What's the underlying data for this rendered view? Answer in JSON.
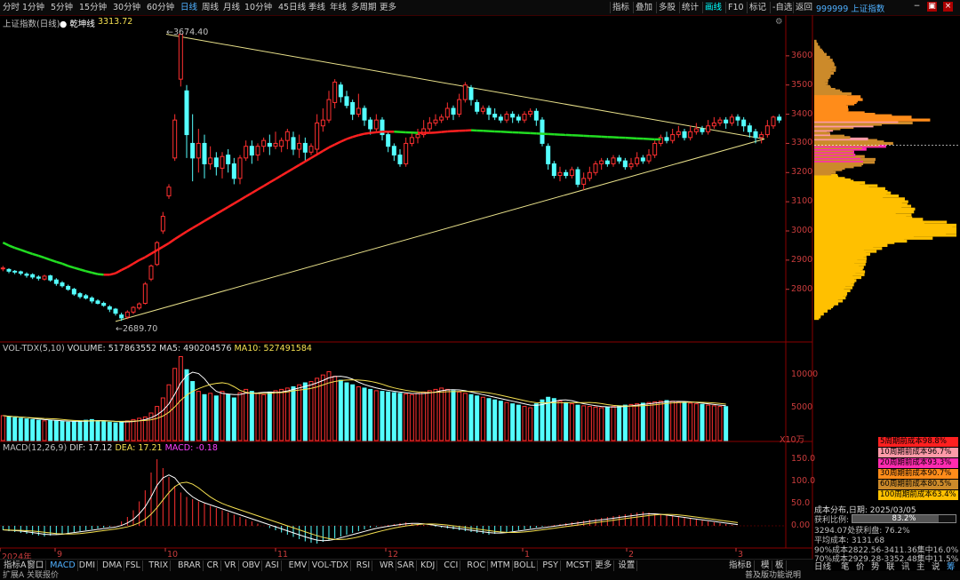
{
  "topbar": {
    "periods": [
      "分时",
      "1分钟",
      "5分钟",
      "15分钟",
      "30分钟",
      "60分钟",
      "日线",
      "周线",
      "月线",
      "10分钟",
      "45日线",
      "季线",
      "年线",
      "多周期",
      "更多"
    ],
    "active_period": "日线",
    "tools": [
      "指标",
      "叠加",
      "多股",
      "统计",
      "画线",
      "F10",
      "标记",
      "-自选",
      "返回"
    ],
    "active_tool": "画线",
    "symbol": "999999 上证指数"
  },
  "main_chart": {
    "name": "上证指数(日线)",
    "indicator": "乾坤线",
    "indicator_value": "3313.72",
    "high_label": "3674.40",
    "low_label": "2689.70",
    "y_ticks": [
      "3600",
      "3500",
      "3400",
      "3300",
      "3200",
      "3100",
      "3000",
      "2900",
      "2800"
    ]
  },
  "vol_panel": {
    "header_name": "VOL-TDX(5,10)",
    "volume": "VOLUME: 517863552",
    "ma5": "MA5: 490204576",
    "ma10": "MA10: 527491584",
    "y_ticks": [
      "10000",
      "5000"
    ],
    "unit": "X10万"
  },
  "macd_panel": {
    "header_name": "MACD(12,26,9)",
    "dif": "DIF: 17.12",
    "dea": "DEA: 17.21",
    "macd": "MACD: -0.18",
    "y_ticks": [
      "150.0",
      "100.0",
      "50.0",
      "0.00"
    ]
  },
  "x_axis": {
    "labels": [
      "2024年",
      "9",
      "10",
      "11",
      "12",
      "1",
      "2",
      "3"
    ]
  },
  "bottom_tabs": [
    "指标A",
    "窗口",
    "MACD",
    "DMI",
    "DMA",
    "FSL",
    "TRIX",
    "BRAR",
    "CR",
    "VR",
    "OBV",
    "ASI",
    "EMV",
    "VOL-TDX",
    "RSI",
    "WR",
    "SAR",
    "KDJ",
    "CCI",
    "ROC",
    "MTM",
    "BOLL",
    "PSY",
    "MCST",
    "更多",
    "设置"
  ],
  "active_bottom_tab": "MACD",
  "bottom_right_tools": [
    "指标B",
    "模",
    "板"
  ],
  "status_left": [
    "扩展A",
    "关联报价"
  ],
  "side_panel": {
    "cost_legend": [
      {
        "label": "5周期前成本98.8%",
        "color": "#ff2020"
      },
      {
        "label": "10周期前成本96.7%",
        "color": "#ff9aa8"
      },
      {
        "label": "20周期前成本93.3%",
        "color": "#ff2bb0"
      },
      {
        "label": "30周期前成本90.7%",
        "color": "#ff8c1a"
      },
      {
        "label": "60周期前成本80.5%",
        "color": "#cc8a2a"
      },
      {
        "label": "100周期前成本63.4%",
        "color": "#ffc000"
      }
    ],
    "dist_date": "成本分布,日期: 2025/03/05",
    "profit_label": "获利比例:",
    "profit_value": "83.2%",
    "line1": "3294.07处获利盘: 76.2%",
    "line2": "平均成本: 3131.68",
    "line3": "90%成本2822.56-3411.36集中16.0%",
    "line4": "70%成本2929.28-3352.48集中11.5%",
    "right_tabs": [
      "日线",
      "笔",
      "价",
      "势",
      "联",
      "讯",
      "主",
      "说",
      "筹"
    ],
    "status_right": "普及版功能说明"
  },
  "chart_data": {
    "type": "candlestick",
    "y_range": [
      2650,
      3700
    ],
    "candles": [
      [
        2870,
        2873,
        2880,
        2862
      ],
      [
        2868,
        2862,
        2872,
        2855
      ],
      [
        2862,
        2860,
        2866,
        2852
      ],
      [
        2860,
        2855,
        2864,
        2848
      ],
      [
        2852,
        2848,
        2858,
        2840
      ],
      [
        2850,
        2842,
        2855,
        2835
      ],
      [
        2842,
        2838,
        2848,
        2830
      ],
      [
        2835,
        2845,
        2850,
        2830
      ],
      [
        2846,
        2832,
        2850,
        2826
      ],
      [
        2832,
        2820,
        2838,
        2812
      ],
      [
        2822,
        2812,
        2828,
        2806
      ],
      [
        2810,
        2800,
        2816,
        2795
      ],
      [
        2800,
        2784,
        2805,
        2778
      ],
      [
        2785,
        2775,
        2790,
        2768
      ],
      [
        2778,
        2770,
        2784,
        2765
      ],
      [
        2770,
        2760,
        2776,
        2752
      ],
      [
        2760,
        2752,
        2766,
        2748
      ],
      [
        2752,
        2745,
        2758,
        2740
      ],
      [
        2740,
        2732,
        2746,
        2722
      ],
      [
        2732,
        2718,
        2736,
        2710
      ],
      [
        2712,
        2702,
        2720,
        2692
      ],
      [
        2705,
        2722,
        2728,
        2698
      ],
      [
        2722,
        2738,
        2742,
        2715
      ],
      [
        2736,
        2750,
        2755,
        2730
      ],
      [
        2752,
        2818,
        2825,
        2748
      ],
      [
        2835,
        2880,
        2885,
        2828
      ],
      [
        2885,
        2960,
        2965,
        2880
      ],
      [
        3000,
        3050,
        3065,
        2990
      ],
      [
        3120,
        3150,
        3160,
        3110
      ],
      [
        3250,
        3380,
        3400,
        3240
      ],
      [
        3520,
        3674,
        3674,
        3495
      ],
      [
        3480,
        3330,
        3500,
        3250
      ],
      [
        3300,
        3250,
        3400,
        3170
      ],
      [
        3250,
        3300,
        3350,
        3200
      ],
      [
        3300,
        3230,
        3330,
        3180
      ],
      [
        3230,
        3250,
        3290,
        3210
      ],
      [
        3250,
        3220,
        3270,
        3190
      ],
      [
        3215,
        3255,
        3270,
        3180
      ],
      [
        3260,
        3230,
        3280,
        3200
      ],
      [
        3230,
        3180,
        3250,
        3160
      ],
      [
        3180,
        3250,
        3260,
        3160
      ],
      [
        3250,
        3290,
        3310,
        3240
      ],
      [
        3290,
        3260,
        3310,
        3230
      ],
      [
        3260,
        3290,
        3300,
        3240
      ],
      [
        3290,
        3310,
        3320,
        3270
      ],
      [
        3300,
        3290,
        3330,
        3260
      ],
      [
        3290,
        3300,
        3340,
        3280
      ],
      [
        3290,
        3310,
        3320,
        3270
      ],
      [
        3310,
        3340,
        3350,
        3280
      ],
      [
        3320,
        3280,
        3340,
        3260
      ],
      [
        3280,
        3300,
        3330,
        3250
      ],
      [
        3300,
        3270,
        3320,
        3240
      ],
      [
        3270,
        3290,
        3300,
        3260
      ],
      [
        3280,
        3370,
        3400,
        3260
      ],
      [
        3360,
        3380,
        3420,
        3340
      ],
      [
        3380,
        3450,
        3480,
        3370
      ],
      [
        3440,
        3510,
        3520,
        3420
      ],
      [
        3500,
        3460,
        3510,
        3440
      ],
      [
        3460,
        3430,
        3480,
        3420
      ],
      [
        3440,
        3400,
        3450,
        3380
      ],
      [
        3400,
        3420,
        3470,
        3390
      ],
      [
        3420,
        3380,
        3430,
        3360
      ],
      [
        3380,
        3350,
        3390,
        3330
      ],
      [
        3350,
        3380,
        3400,
        3340
      ],
      [
        3380,
        3330,
        3390,
        3310
      ],
      [
        3330,
        3290,
        3340,
        3270
      ],
      [
        3290,
        3260,
        3300,
        3240
      ],
      [
        3260,
        3230,
        3280,
        3220
      ],
      [
        3230,
        3300,
        3320,
        3220
      ],
      [
        3300,
        3320,
        3340,
        3290
      ],
      [
        3320,
        3330,
        3350,
        3300
      ],
      [
        3330,
        3350,
        3380,
        3320
      ],
      [
        3350,
        3370,
        3390,
        3340
      ],
      [
        3370,
        3380,
        3400,
        3360
      ],
      [
        3380,
        3390,
        3400,
        3370
      ],
      [
        3390,
        3420,
        3440,
        3380
      ],
      [
        3420,
        3400,
        3430,
        3380
      ],
      [
        3400,
        3450,
        3470,
        3390
      ],
      [
        3450,
        3500,
        3510,
        3440
      ],
      [
        3490,
        3450,
        3500,
        3430
      ],
      [
        3440,
        3410,
        3450,
        3400
      ],
      [
        3410,
        3420,
        3430,
        3400
      ],
      [
        3420,
        3400,
        3430,
        3380
      ],
      [
        3400,
        3390,
        3420,
        3380
      ],
      [
        3390,
        3380,
        3400,
        3370
      ],
      [
        3380,
        3400,
        3410,
        3370
      ],
      [
        3400,
        3390,
        3410,
        3370
      ],
      [
        3390,
        3380,
        3400,
        3370
      ],
      [
        3380,
        3400,
        3410,
        3370
      ],
      [
        3400,
        3410,
        3420,
        3390
      ],
      [
        3410,
        3380,
        3420,
        3360
      ],
      [
        3380,
        3300,
        3390,
        3290
      ],
      [
        3290,
        3230,
        3300,
        3210
      ],
      [
        3230,
        3190,
        3240,
        3180
      ],
      [
        3190,
        3200,
        3220,
        3170
      ],
      [
        3200,
        3190,
        3210,
        3180
      ],
      [
        3190,
        3210,
        3220,
        3180
      ],
      [
        3210,
        3160,
        3220,
        3150
      ],
      [
        3160,
        3180,
        3200,
        3140
      ],
      [
        3180,
        3200,
        3220,
        3170
      ],
      [
        3200,
        3230,
        3240,
        3190
      ],
      [
        3230,
        3240,
        3250,
        3210
      ],
      [
        3240,
        3230,
        3250,
        3220
      ],
      [
        3230,
        3250,
        3260,
        3220
      ],
      [
        3250,
        3240,
        3260,
        3230
      ],
      [
        3240,
        3220,
        3250,
        3210
      ],
      [
        3220,
        3230,
        3250,
        3210
      ],
      [
        3230,
        3250,
        3270,
        3220
      ],
      [
        3250,
        3240,
        3260,
        3230
      ],
      [
        3240,
        3260,
        3280,
        3230
      ],
      [
        3260,
        3300,
        3310,
        3250
      ],
      [
        3300,
        3320,
        3330,
        3290
      ],
      [
        3320,
        3310,
        3340,
        3300
      ],
      [
        3310,
        3330,
        3350,
        3300
      ],
      [
        3330,
        3340,
        3360,
        3320
      ],
      [
        3340,
        3320,
        3350,
        3310
      ],
      [
        3320,
        3340,
        3360,
        3310
      ],
      [
        3340,
        3350,
        3370,
        3330
      ],
      [
        3350,
        3340,
        3360,
        3330
      ],
      [
        3340,
        3360,
        3380,
        3330
      ],
      [
        3360,
        3370,
        3390,
        3350
      ],
      [
        3370,
        3380,
        3390,
        3360
      ],
      [
        3380,
        3370,
        3390,
        3350
      ],
      [
        3370,
        3390,
        3400,
        3360
      ],
      [
        3390,
        3380,
        3400,
        3360
      ],
      [
        3380,
        3360,
        3390,
        3340
      ],
      [
        3360,
        3340,
        3370,
        3320
      ],
      [
        3340,
        3320,
        3350,
        3300
      ],
      [
        3320,
        3330,
        3340,
        3300
      ],
      [
        3330,
        3360,
        3380,
        3320
      ],
      [
        3360,
        3390,
        3395,
        3350
      ],
      [
        3390,
        3380,
        3400,
        3370
      ]
    ],
    "ma_line": [
      2960,
      2950,
      2942,
      2935,
      2928,
      2921,
      2915,
      2908,
      2901,
      2894,
      2888,
      2880,
      2874,
      2868,
      2862,
      2857,
      2852,
      2850,
      2850,
      2855,
      2866,
      2876,
      2888,
      2900,
      2910,
      2922,
      2934,
      2946,
      2958,
      2972,
      2985,
      2998,
      3010,
      3022,
      3034,
      3046,
      3058,
      3070,
      3082,
      3094,
      3106,
      3118,
      3130,
      3142,
      3154,
      3166,
      3178,
      3190,
      3202,
      3214,
      3226,
      3238,
      3250,
      3262,
      3274,
      3286,
      3296,
      3306,
      3315,
      3322,
      3328,
      3333,
      3336,
      3338,
      3340,
      3340,
      3340,
      3339,
      3338,
      3337,
      3336,
      3336,
      3336,
      3337,
      3339,
      3341,
      3342,
      3343,
      3344,
      3345,
      3344,
      3343,
      3342,
      3341,
      3340,
      3339,
      3338,
      3337,
      3336,
      3335,
      3334,
      3333,
      3332,
      3331,
      3330,
      3329,
      3328,
      3327,
      3326,
      3325,
      3324,
      3323,
      3322,
      3321,
      3320,
      3319,
      3318,
      3317,
      3316,
      3315,
      3314,
      3313.72
    ],
    "volume": [
      3800,
      3600,
      3500,
      3400,
      3300,
      3200,
      3100,
      3000,
      3100,
      3000,
      2900,
      2800,
      2900,
      3000,
      3100,
      3200,
      3000,
      2900,
      2800,
      2700,
      2800,
      3000,
      3200,
      3400,
      3600,
      4200,
      5200,
      6500,
      8500,
      11000,
      12800,
      10800,
      9000,
      7500,
      7000,
      7200,
      6800,
      7500,
      7000,
      6500,
      7300,
      7800,
      7500,
      7200,
      7000,
      7400,
      7600,
      7800,
      8000,
      8200,
      8500,
      8800,
      9000,
      9500,
      10000,
      10500,
      9800,
      9200,
      8800,
      8500,
      8200,
      8000,
      7800,
      7600,
      7500,
      7400,
      7300,
      7200,
      7100,
      7000,
      7200,
      7400,
      7600,
      7800,
      8000,
      7800,
      7600,
      7400,
      7200,
      7000,
      6800,
      6600,
      6400,
      6200,
      6000,
      5800,
      5600,
      5400,
      5200,
      5000,
      5600,
      6200,
      6600,
      6400,
      6000,
      5800,
      5600,
      5400,
      5300,
      5200,
      5100,
      5000,
      5100,
      5200,
      5300,
      5400,
      5500,
      5600,
      5700,
      5800,
      5900,
      6000,
      6100,
      6000,
      5900,
      5800,
      5700,
      5600,
      5500,
      5400,
      5300,
      5200,
      5178
    ],
    "macd": [
      -10,
      -12,
      -14,
      -16,
      -18,
      -20,
      -22,
      -24,
      -22,
      -20,
      -18,
      -16,
      -14,
      -12,
      -10,
      -8,
      -6,
      -4,
      -2,
      0,
      10,
      20,
      35,
      55,
      80,
      120,
      150,
      130,
      110,
      90,
      75,
      65,
      60,
      55,
      50,
      45,
      40,
      35,
      30,
      25,
      20,
      15,
      10,
      5,
      0,
      -5,
      -10,
      -15,
      -20,
      -25,
      -30,
      -35,
      -38,
      -40,
      -36,
      -32,
      -28,
      -24,
      -20,
      -16,
      -12,
      -8,
      -4,
      -2,
      0,
      2,
      4,
      6,
      8,
      6,
      4,
      2,
      0,
      -2,
      -4,
      -6,
      -8,
      -10,
      -12,
      -14,
      -16,
      -18,
      -20,
      -18,
      -16,
      -14,
      -12,
      -10,
      -8,
      -6,
      -4,
      -2,
      0,
      2,
      4,
      6,
      8,
      10,
      12,
      14,
      16,
      18,
      20,
      22,
      24,
      26,
      28,
      30,
      32,
      30,
      28,
      26,
      24,
      22,
      20,
      18,
      16,
      14,
      12,
      10,
      8,
      6,
      4,
      2,
      0
    ]
  }
}
